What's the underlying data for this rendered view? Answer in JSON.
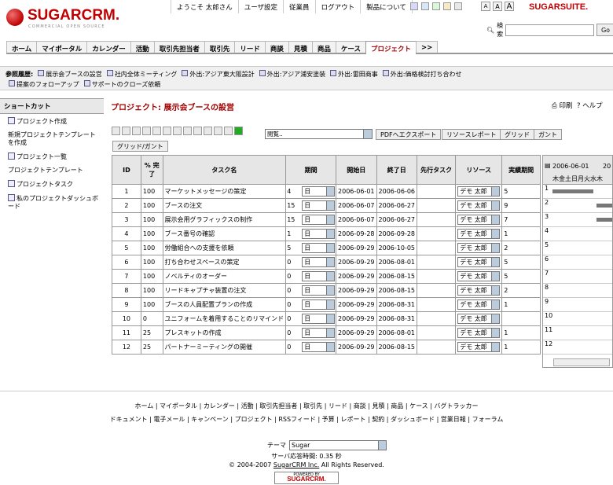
{
  "brand": {
    "logo_text": "SUGARCRM.",
    "logo_sub": "COMMERCIAL OPEN SOURCE",
    "suite": "SUGARSUITE."
  },
  "toplinks": [
    "ようこそ 太郎さん",
    "ユーザ設定",
    "従業員",
    "ログアウト",
    "製品について"
  ],
  "search": {
    "label": "検索",
    "value": "",
    "button": "Go"
  },
  "tabs": [
    "ホーム",
    "マイポータル",
    "カレンダー",
    "活動",
    "取引先担当者",
    "取引先",
    "リード",
    "商談",
    "見積",
    "商品",
    "ケース",
    "プロジェクト",
    ">>"
  ],
  "history": {
    "label": "参照履歴:",
    "row1": [
      "展示会ブースの設営",
      "社内全体ミーティング",
      "外出:アジア東大阪設計",
      "外出:アジア浦安塗装",
      "外出:雷田商事",
      "外出:価格検討打ち合わせ"
    ],
    "row2": [
      "提案のフォローアップ",
      "サポートのクローズ依頼"
    ]
  },
  "sidebar": {
    "title": "ショートカット",
    "items": [
      "プロジェクト作成",
      "新規プロジェクトテンプレートを作成",
      "プロジェクト一覧",
      "プロジェクトテンプレート",
      "プロジェクトタスク",
      "私のプロジェクトダッシュボード"
    ]
  },
  "page": {
    "title": "プロジェクト: 展示会ブースの設営",
    "print": "印刷",
    "help": "ヘルプ"
  },
  "toolbar": {
    "view_select": "閲覧..",
    "pdf": "PDFへエクスポート",
    "resource_report": "リソースレポート",
    "grid": "グリッド",
    "gantt": "ガント",
    "grid_gantt": "グリッド/ガント"
  },
  "grid": {
    "headers": [
      "ID",
      "% 完了",
      "タスク名",
      "期間",
      "開始日",
      "終了日",
      "先行タスク",
      "リソース",
      "実績期間"
    ],
    "rows": [
      {
        "id": "1",
        "pct": "100",
        "name": "マーケットメッセージの策定",
        "dur": "4",
        "unit": "日",
        "start": "2006-06-01",
        "end": "2006-06-06",
        "pred": "",
        "res": "デモ 太郎",
        "actual": "5"
      },
      {
        "id": "2",
        "pct": "100",
        "name": "ブースの注文",
        "dur": "15",
        "unit": "日",
        "start": "2006-06-07",
        "end": "2006-06-27",
        "pred": "",
        "res": "デモ 太郎",
        "actual": "9"
      },
      {
        "id": "3",
        "pct": "100",
        "name": "展示会用グラフィックスの制作",
        "dur": "15",
        "unit": "日",
        "start": "2006-06-07",
        "end": "2006-06-27",
        "pred": "",
        "res": "デモ 太郎",
        "actual": "7"
      },
      {
        "id": "4",
        "pct": "100",
        "name": "ブース番号の確認",
        "dur": "1",
        "unit": "日",
        "start": "2006-09-28",
        "end": "2006-09-28",
        "pred": "",
        "res": "デモ 太郎",
        "actual": "1"
      },
      {
        "id": "5",
        "pct": "100",
        "name": "労働組合への支援を依頼",
        "dur": "5",
        "unit": "日",
        "start": "2006-09-29",
        "end": "2006-10-05",
        "pred": "",
        "res": "デモ 太郎",
        "actual": "2"
      },
      {
        "id": "6",
        "pct": "100",
        "name": "打ち合わせスペースの策定",
        "dur": "0",
        "unit": "日",
        "start": "2006-09-29",
        "end": "2006-08-01",
        "pred": "",
        "res": "デモ 太郎",
        "actual": "5"
      },
      {
        "id": "7",
        "pct": "100",
        "name": "ノベルティのオーダー",
        "dur": "0",
        "unit": "日",
        "start": "2006-09-29",
        "end": "2006-08-15",
        "pred": "",
        "res": "デモ 太郎",
        "actual": "5"
      },
      {
        "id": "8",
        "pct": "100",
        "name": "リードキャプチャ装置の注文",
        "dur": "0",
        "unit": "日",
        "start": "2006-09-29",
        "end": "2006-08-15",
        "pred": "",
        "res": "デモ 太郎",
        "actual": "2"
      },
      {
        "id": "9",
        "pct": "100",
        "name": "ブースの人員配置プランの作成",
        "dur": "0",
        "unit": "日",
        "start": "2006-09-29",
        "end": "2006-08-31",
        "pred": "",
        "res": "デモ 太郎",
        "actual": "1"
      },
      {
        "id": "10",
        "pct": "0",
        "name": "ユニフォームを着用することのリマインド",
        "dur": "0",
        "unit": "日",
        "start": "2006-09-29",
        "end": "2006-08-31",
        "pred": "",
        "res": "デモ 太郎",
        "actual": ""
      },
      {
        "id": "11",
        "pct": "25",
        "name": "プレスキットの作成",
        "dur": "0",
        "unit": "日",
        "start": "2006-09-29",
        "end": "2006-08-01",
        "pred": "",
        "res": "デモ 太郎",
        "actual": "1"
      },
      {
        "id": "12",
        "pct": "25",
        "name": "パートナーミーティングの開催",
        "dur": "0",
        "unit": "日",
        "start": "2006-09-29",
        "end": "2006-08-15",
        "pred": "",
        "res": "デモ 太郎",
        "actual": "1"
      }
    ]
  },
  "gantt": {
    "date_label": "2006-06-01",
    "date_label2": "20",
    "days": "木金土日月火水木",
    "row_ids": [
      "1",
      "2",
      "3",
      "4",
      "5",
      "6",
      "7",
      "8",
      "9",
      "10",
      "11",
      "12"
    ]
  },
  "footer": {
    "links1": "ホーム | マイポータル | カレンダー | 活動 | 取引先担当者 | 取引先 | リード | 商談 | 見積 | 商品 | ケース | バグトラッカー",
    "links2": "ドキュメント | 電子メール | キャンペーン | プロジェクト | RSSフィード | 予算 | レポート | 契約 | ダッシュボード | 営業日報 | フォーラム",
    "theme_label": "テーマ",
    "theme_value": "Sugar",
    "response": "サーバ応答時間: 0.35 秒",
    "copyright_pre": "© 2004-2007 ",
    "copyright_link": "SugarCRM Inc.",
    "copyright_post": " All Rights Reserved.",
    "powered_by": "POWERED BY",
    "powered_brand": "SUGARCRM."
  },
  "colors": {
    "brand_red": "#c00000",
    "title_red": "#a00000",
    "gantt_bar": "#777777"
  }
}
